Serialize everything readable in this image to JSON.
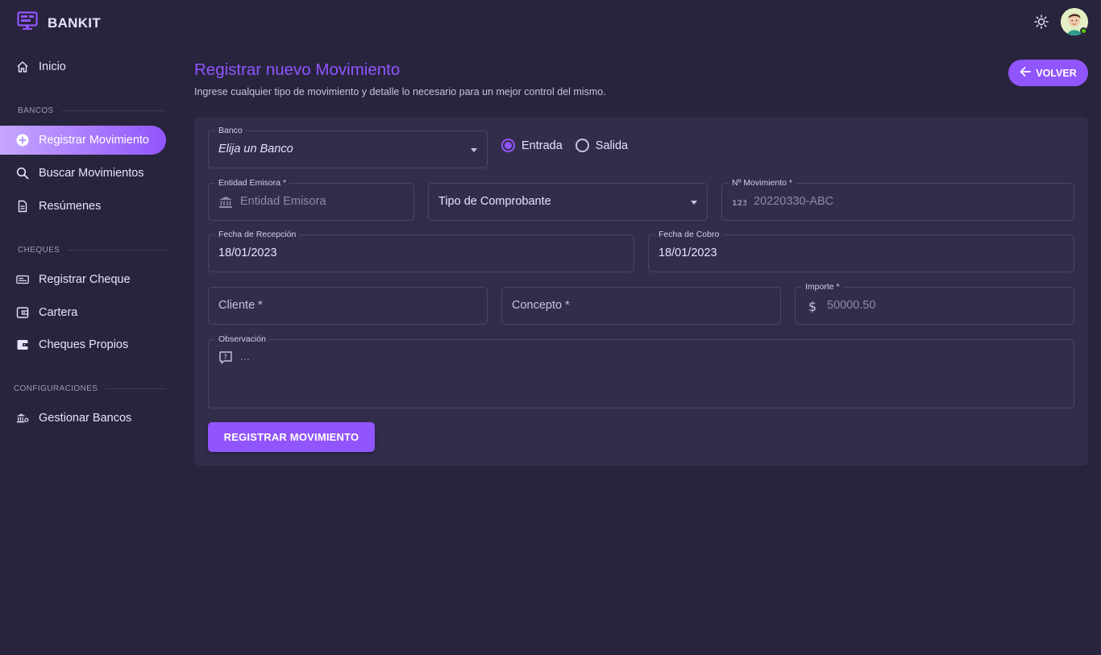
{
  "app": {
    "brand": "BANKIT"
  },
  "sidebar": {
    "items": [
      {
        "label": "Inicio"
      },
      {
        "section": "BANCOS"
      },
      {
        "label": "Registrar Movimiento"
      },
      {
        "label": "Buscar Movimientos"
      },
      {
        "label": "Resúmenes"
      },
      {
        "section": "CHEQUES"
      },
      {
        "label": "Registrar Cheque"
      },
      {
        "label": "Cartera"
      },
      {
        "label": "Cheques Propios"
      },
      {
        "section": "CONFIGURACIONES"
      },
      {
        "label": "Gestionar Bancos"
      }
    ],
    "active": "Registrar Movimiento"
  },
  "page": {
    "title": "Registrar nuevo Movimiento",
    "subtitle": "Ingrese cualquier tipo de movimiento y detalle lo necesario para un mejor control del mismo.",
    "back_label": "VOLVER"
  },
  "form": {
    "banco": {
      "label": "Banco",
      "value": "Elija un Banco"
    },
    "tipo_radio": {
      "options": [
        "Entrada",
        "Salida"
      ],
      "selected": "Entrada"
    },
    "entidad": {
      "label": "Entidad Emisora *",
      "placeholder": "Entidad Emisora"
    },
    "tipo_comprobante": {
      "value": "Tipo de Comprobante"
    },
    "nro_movimiento": {
      "label": "Nº Movimiento *",
      "placeholder": "20220330-ABC"
    },
    "fecha_recepcion": {
      "label": "Fecha de Recepción",
      "value": "18/01/2023"
    },
    "fecha_cobro": {
      "label": "Fecha de Cobro",
      "value": "18/01/2023"
    },
    "cliente": {
      "placeholder": "Cliente *"
    },
    "concepto": {
      "placeholder": "Concepto *"
    },
    "importe": {
      "label": "Importe *",
      "placeholder": "50000.50"
    },
    "observacion": {
      "label": "Observación",
      "placeholder": "..."
    },
    "submit_label": "REGISTRAR MOVIMIENTO"
  },
  "colors": {
    "accent": "#9155fd",
    "background": "#28243d",
    "card": "#312d4b"
  }
}
